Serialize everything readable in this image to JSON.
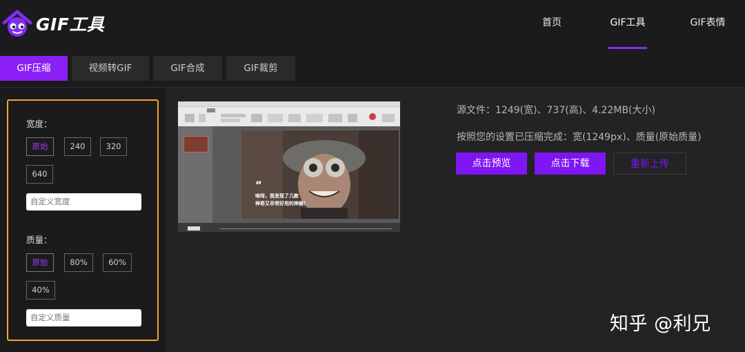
{
  "header": {
    "logo_text": "GIF工具",
    "nav": [
      {
        "label": "首页"
      },
      {
        "label": "GIF工具",
        "active": true
      },
      {
        "label": "GIF表情"
      }
    ]
  },
  "tabs": [
    {
      "label": "GIF压缩",
      "active": true
    },
    {
      "label": "视频转GIF"
    },
    {
      "label": "GIF合成"
    },
    {
      "label": "GIF裁剪"
    }
  ],
  "settings": {
    "width": {
      "label": "宽度：",
      "options": [
        "原始",
        "240",
        "320",
        "640"
      ],
      "selected": "原始",
      "custom_placeholder": "自定义宽度"
    },
    "quality": {
      "label": "质量：",
      "options": [
        "原始",
        "80%",
        "60%",
        "40%"
      ],
      "selected": "原始",
      "custom_placeholder": "自定义质量"
    }
  },
  "preview": {
    "caption_line1": "唉呀，我发现了几款",
    "caption_line2": "神奇又非常好用的神器！"
  },
  "info": {
    "source": "源文件：1249(宽)、737(高)、4.22MB(大小)",
    "result": "按照您的设置已压缩完成：宽(1249px)、质量(原始质量)"
  },
  "actions": {
    "preview_label": "点击预览",
    "download_label": "点击下载",
    "reupload_label": "重新上传"
  },
  "watermark": "知乎 @利兄",
  "colors": {
    "accent": "#8b1ff5",
    "highlight_border": "#f2a52d",
    "background": "#1b1b1d"
  }
}
